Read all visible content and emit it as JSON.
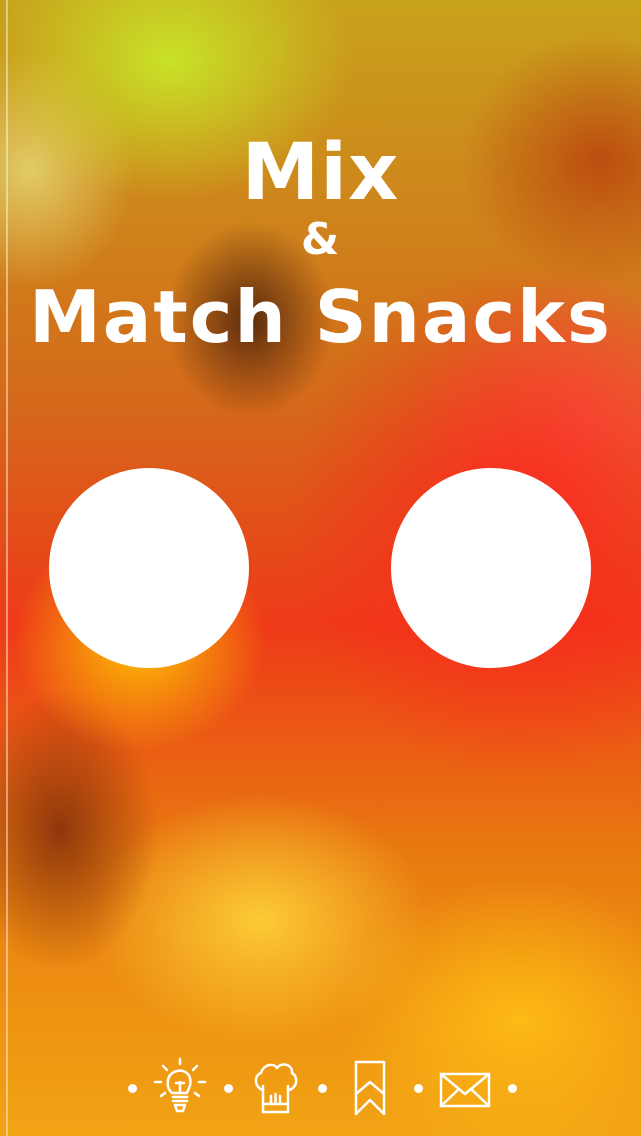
{
  "app": {
    "title_line1": "Mix",
    "title_line2": "&",
    "title_line3": "Match Snacks"
  },
  "snack_slots": [
    {
      "name": "left-snack-slot",
      "color": "#ffffff"
    },
    {
      "name": "right-snack-slot",
      "color": "#ffffff"
    }
  ],
  "toolbar": {
    "items": [
      {
        "icon": "lightbulb-icon"
      },
      {
        "icon": "chef-hat-icon"
      },
      {
        "icon": "bookmark-icon"
      },
      {
        "icon": "envelope-icon"
      }
    ]
  },
  "colors": {
    "foreground": "#ffffff",
    "accent_red": "#f0281e",
    "accent_yellow": "#ffd200",
    "accent_green": "#b4dc28"
  }
}
